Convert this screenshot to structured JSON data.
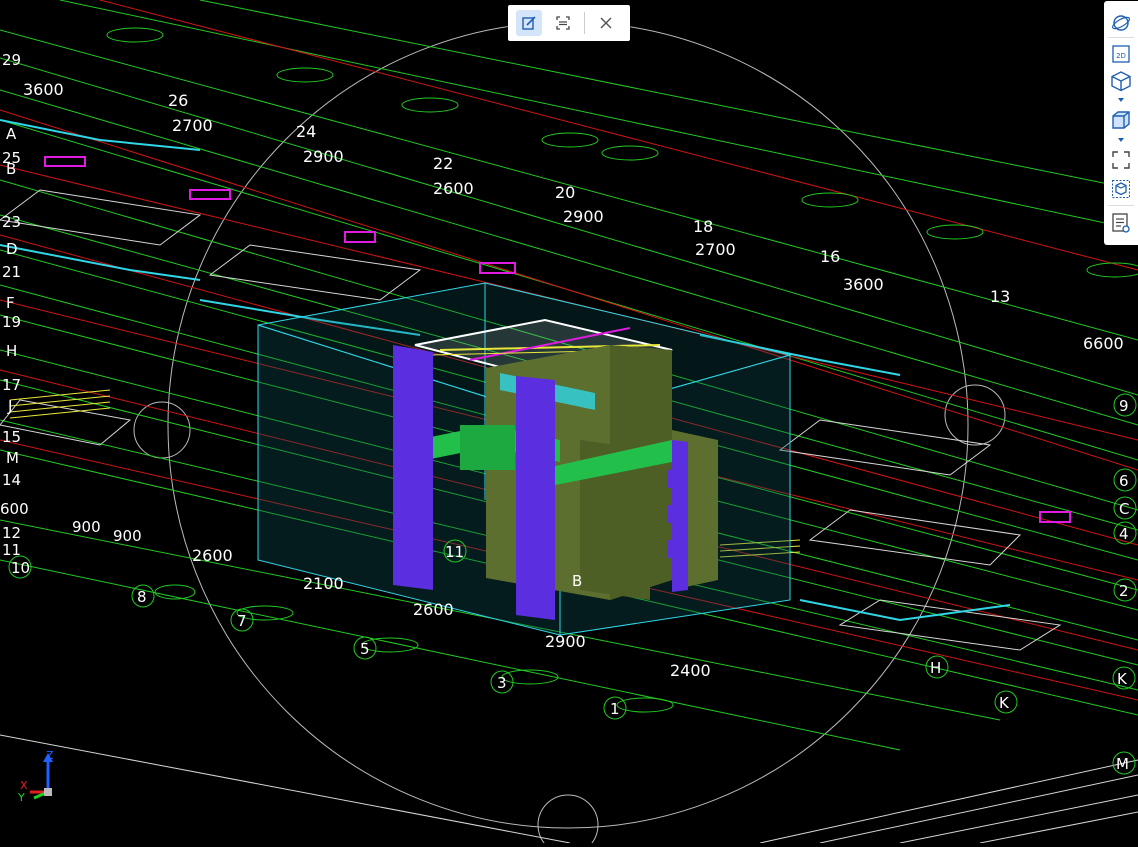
{
  "toolbar": {
    "edit_icon": "edit-icon",
    "scan_icon": "scan-icon",
    "close_icon": "close-icon"
  },
  "view_tools": {
    "orbit_icon": "orbit-icon",
    "view_2d_label": "2D",
    "view_3d_icon": "cube-view-icon",
    "box_icon": "solid-box-icon",
    "fit_icon": "fit-view-icon",
    "section_icon": "section-box-icon",
    "properties_icon": "properties-icon"
  },
  "colors": {
    "background": "#000000",
    "grid_line": "#22c922",
    "axis_red": "#d01515",
    "column": "#5b2ee0",
    "beam": "#22c04a",
    "wall": "#5c6f2e",
    "slab_outline": "#2fd6e6",
    "accent_blue": "#1f5fb0"
  },
  "dimensions": [
    {
      "text": "3600"
    },
    {
      "text": "2700"
    },
    {
      "text": "2900"
    },
    {
      "text": "2600"
    },
    {
      "text": "2900"
    },
    {
      "text": "2700"
    },
    {
      "text": "3600"
    },
    {
      "text": "6600"
    },
    {
      "text": "2600"
    },
    {
      "text": "2100"
    },
    {
      "text": "2600"
    },
    {
      "text": "2900"
    },
    {
      "text": "2400"
    },
    {
      "text": "900"
    },
    {
      "text": "900"
    },
    {
      "text": "600"
    }
  ],
  "grid_numbers": [
    {
      "text": "26"
    },
    {
      "text": "24"
    },
    {
      "text": "22"
    },
    {
      "text": "20"
    },
    {
      "text": "18"
    },
    {
      "text": "16"
    },
    {
      "text": "13"
    },
    {
      "text": "9"
    },
    {
      "text": "6"
    },
    {
      "text": "4"
    },
    {
      "text": "2"
    },
    {
      "text": "11"
    },
    {
      "text": "8"
    },
    {
      "text": "7"
    },
    {
      "text": "5"
    },
    {
      "text": "3"
    },
    {
      "text": "1"
    }
  ],
  "left_labels": [
    {
      "text": "29"
    },
    {
      "text": "A"
    },
    {
      "text": "25"
    },
    {
      "text": "B"
    },
    {
      "text": "23"
    },
    {
      "text": "D"
    },
    {
      "text": "21"
    },
    {
      "text": "F"
    },
    {
      "text": "19"
    },
    {
      "text": "H"
    },
    {
      "text": "17"
    },
    {
      "text": "J"
    },
    {
      "text": "15"
    },
    {
      "text": "M"
    },
    {
      "text": "14"
    },
    {
      "text": "12"
    },
    {
      "text": "11"
    },
    {
      "text": "10"
    }
  ],
  "right_labels": [
    {
      "text": "C"
    },
    {
      "text": "H"
    },
    {
      "text": "K"
    },
    {
      "text": "K"
    },
    {
      "text": "M"
    }
  ],
  "marker_b": "B",
  "axis": {
    "z": "Z",
    "x": "X",
    "y": "Y"
  }
}
